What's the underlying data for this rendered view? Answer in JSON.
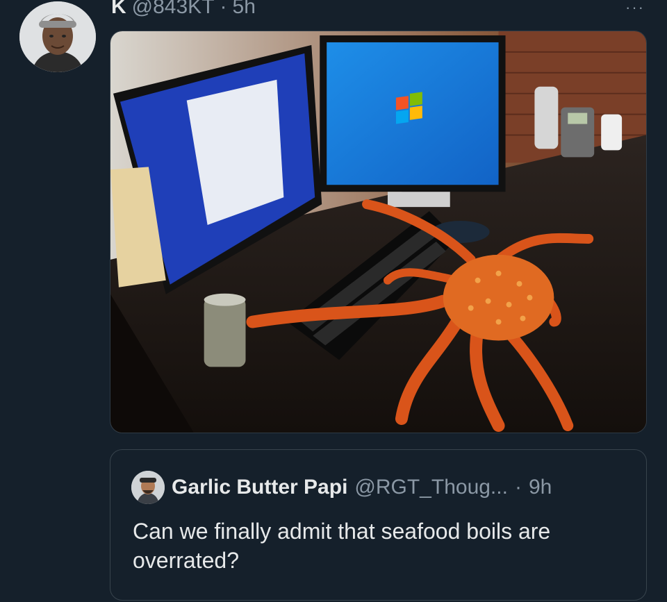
{
  "author": {
    "name": "K",
    "handle": "@843KT",
    "separator": "·",
    "time": "5h"
  },
  "more_menu_label": "···",
  "media": {
    "description_icon": "photo-of-king-crab-at-computer-desk"
  },
  "quote": {
    "name": "Garlic Butter Papi",
    "handle": "@RGT_Thoug...",
    "separator": "·",
    "time": "9h",
    "text": "Can we finally admit that seafood boils are overrated?"
  },
  "colors": {
    "background": "#15202b",
    "text": "#e7e9ea",
    "muted": "#8b98a5",
    "border": "#38444d"
  }
}
